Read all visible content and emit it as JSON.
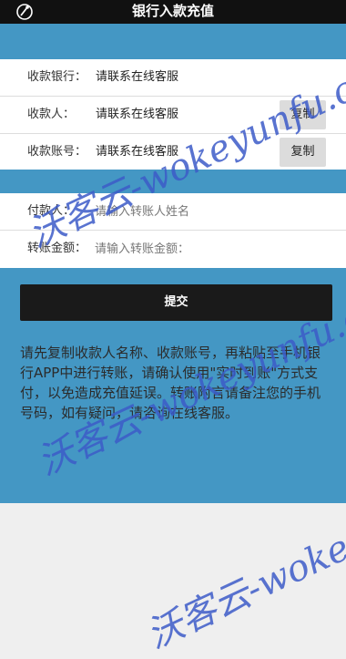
{
  "header": {
    "title": "银行入款充值"
  },
  "account": {
    "bank_label": "收款银行：",
    "bank_value": "请联系在线客服",
    "payee_label": "收款人：",
    "payee_value": "请联系在线客服",
    "number_label": "收款账号：",
    "number_value": "请联系在线客服",
    "copy_label": "复制"
  },
  "form": {
    "payer_label": "付款人：",
    "payer_placeholder": "请输入转账人姓名",
    "amount_label": "转账金额：",
    "amount_placeholder": "请输入转账金额："
  },
  "submit_label": "提交",
  "note": "请先复制收款人名称、收款账号，再粘贴至手机银行APP中进行转账，请确认使用\"实时到账\"方式支付，以免造成充值延误。转账附言请备注您的手机号码，如有疑问，请咨询在线客服。",
  "watermark": "沃客云-wokeyunfu.cn",
  "colors": {
    "accent": "#4497c4",
    "header": "#111111",
    "button": "#1a1a1a"
  }
}
